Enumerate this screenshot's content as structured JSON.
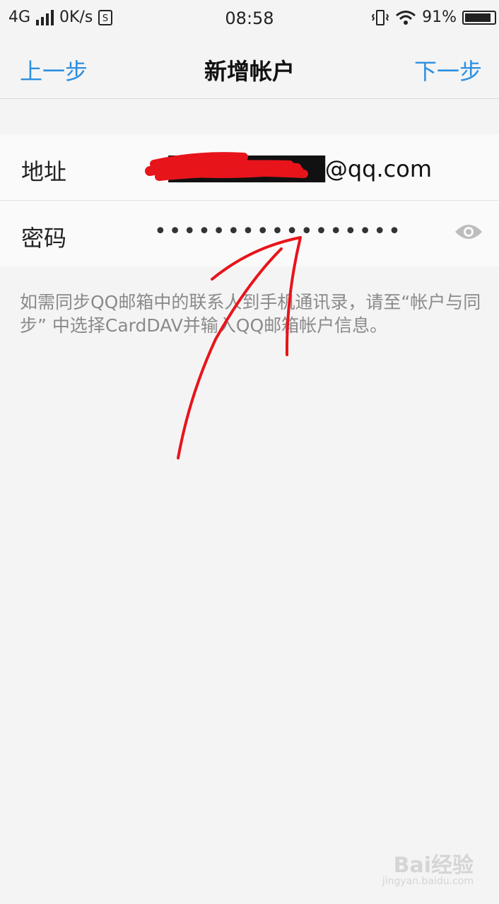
{
  "status_bar": {
    "network": "4G",
    "speed": "0K/s",
    "time": "08:58",
    "battery": "91%",
    "battery_level": 0.91,
    "icons": [
      "signal-icon",
      "sim-icon",
      "vibrate-icon",
      "wifi-icon",
      "battery-icon"
    ]
  },
  "nav": {
    "back_label": "上一步",
    "title": "新增帐户",
    "next_label": "下一步"
  },
  "form": {
    "address_label": "地址",
    "address_value": "1█████████@qq.com",
    "password_label": "密码",
    "password_value": "•••••••••••••••••"
  },
  "info_text": "如需同步QQ邮箱中的联系人到手机通讯录，请至“帐户与同步” 中选择CardDAV并输入QQ邮箱帐户信息。",
  "watermark": {
    "title": "Bai经验",
    "url": "jingyan.baidu.com"
  },
  "colors": {
    "accent": "#2d8fe0",
    "annotation": "#e8141b",
    "background": "#f4f4f4"
  }
}
